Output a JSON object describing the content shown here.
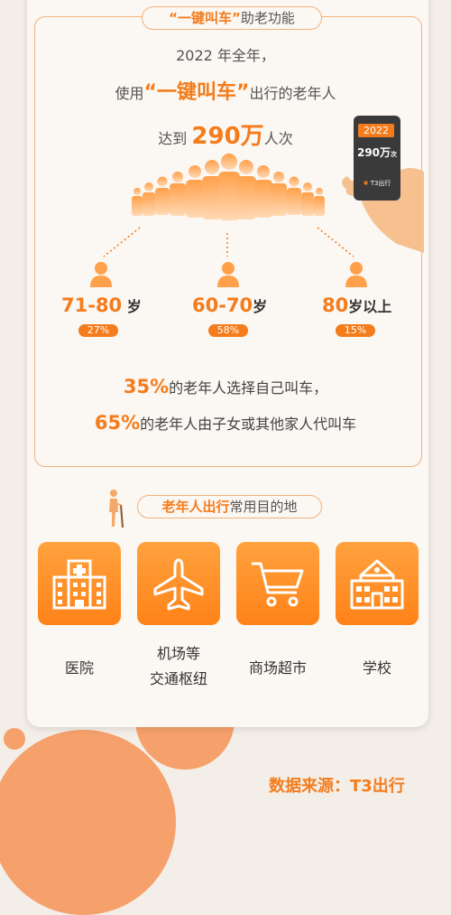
{
  "section1": {
    "title_highlight": "“一键叫车”",
    "title_rest": "助老功能",
    "line1": "2022 年全年，",
    "line2_pre": "使用",
    "line2_highlight": "“一键叫车”",
    "line2_post": "出行的老年人",
    "line3_pre": "达到",
    "line3_highlight": "290万",
    "line3_post": "人次"
  },
  "phone": {
    "year": "2022",
    "value": "290万",
    "unit": "次",
    "brand": "T3出行"
  },
  "age_groups": [
    {
      "range": "71-80",
      "suffix": " 岁",
      "percent": "27%"
    },
    {
      "range": "60-70",
      "suffix": "岁",
      "percent": "58%"
    },
    {
      "range": "80",
      "suffix": "岁以上",
      "percent": "15%"
    }
  ],
  "stats": [
    {
      "value": "35%",
      "text": "的老年人选择自己叫车，"
    },
    {
      "value": "65%",
      "text": "的老年人由子女或其他家人代叫车"
    }
  ],
  "section2": {
    "title_highlight": "老年人出行",
    "title_rest": "常用目的地"
  },
  "destinations": [
    {
      "icon": "hospital-icon",
      "label": "医院"
    },
    {
      "icon": "airplane-icon",
      "label_line1": "机场等",
      "label_line2": "交通枢纽"
    },
    {
      "icon": "shopping-cart-icon",
      "label": "商场超市"
    },
    {
      "icon": "school-icon",
      "label": "学校"
    }
  ],
  "source": "数据来源：T3出行",
  "colors": {
    "accent": "#f47c1c",
    "tile": "#ff8a22",
    "border": "#f3b27c",
    "background": "#f3eee7"
  }
}
